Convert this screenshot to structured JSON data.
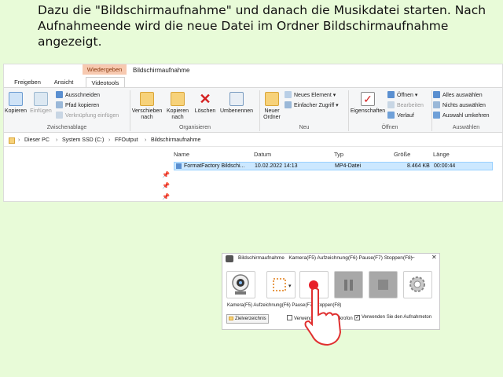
{
  "instruction": "Dazu die \"Bildschirmaufnahme\" und danach die Musikdatei starten. Nach Aufnahmeende wird die neue Datei im Ordner Bildschirmaufnahme angezeigt.",
  "explorer": {
    "context_tab": "Wiedergeben",
    "window_title": "Bildschirmaufnahme",
    "tabs": [
      "Freigeben",
      "Ansicht",
      "Videotools"
    ],
    "ribbon": {
      "clipboard": {
        "copy": "Kopieren",
        "paste": "Einfügen",
        "cut": "Ausschneiden",
        "copy_path": "Pfad kopieren",
        "paste_shortcut": "Verknüpfung einfügen",
        "label": "Zwischenablage"
      },
      "organize": {
        "move_to_1": "Verschieben",
        "move_to_2": "nach",
        "copy_to_1": "Kopieren",
        "copy_to_2": "nach",
        "delete": "Löschen",
        "rename": "Umbenennen",
        "label": "Organisieren"
      },
      "new": {
        "new_folder_1": "Neuer",
        "new_folder_2": "Ordner",
        "new_item": "Neues Element",
        "easy_access": "Einfacher Zugriff",
        "label": "Neu"
      },
      "open": {
        "properties": "Eigenschaften",
        "open": "Öffnen",
        "edit": "Bearbeiten",
        "history": "Verlauf",
        "label": "Öffnen"
      },
      "select": {
        "select_all": "Alles auswählen",
        "select_none": "Nichts auswählen",
        "invert": "Auswahl umkehren",
        "label": "Auswählen"
      }
    },
    "breadcrumb": [
      "Dieser PC",
      "System SSD (C:)",
      "FFOutput",
      "Bildschirmaufnahme"
    ],
    "columns": [
      "Name",
      "Datum",
      "Typ",
      "Größe",
      "Länge"
    ],
    "file": {
      "name": "FormatFactory Bildschi...",
      "date": "10.02.2022 14:13",
      "type": "MP4-Datei",
      "size": "8.464 KB",
      "length": "00:00:44"
    }
  },
  "recorder": {
    "title": "Bildschirmaufnahme",
    "shortcuts": "Kamera(F5) Aufzeichnung(F6) Pause(F7) Stoppen(F8)",
    "labels": "Kamera(F5) Aufzeichnung(F6) Pause(F7) Stoppen(F8)",
    "folder_button": "Zielverzeichnis",
    "option_mouse": "Verwenden Sie ein Mikrofon",
    "option_anim": "Verwenden Sie den Aufnahmeton",
    "colors": {
      "record": "#e8202a",
      "hand": "#e03030"
    }
  }
}
